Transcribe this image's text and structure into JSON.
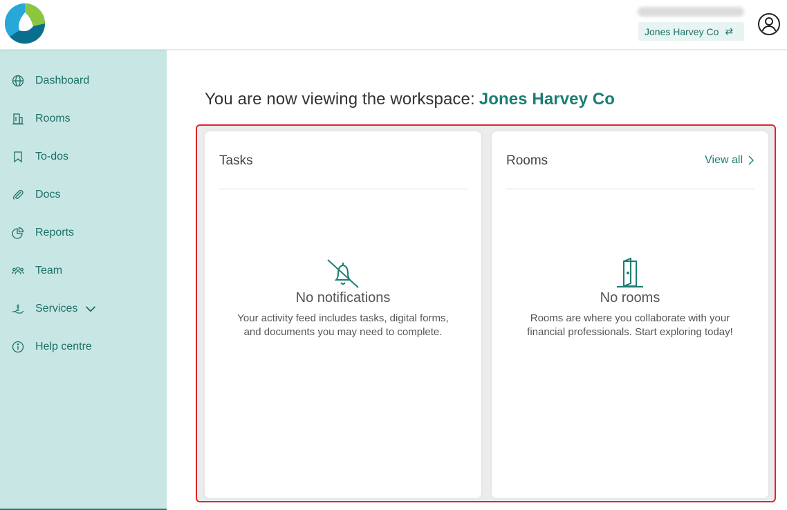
{
  "header": {
    "workspace_switch_label": "Jones Harvey Co",
    "swap_glyph": "⇄",
    "icons": {
      "logo": "app-logo",
      "account": "user-account-icon",
      "swap": "swap-arrows-icon"
    }
  },
  "sidebar": {
    "items": [
      {
        "label": "Dashboard",
        "icon": "globe-icon"
      },
      {
        "label": "Rooms",
        "icon": "building-icon"
      },
      {
        "label": "To-dos",
        "icon": "bookmark-icon"
      },
      {
        "label": "Docs",
        "icon": "paperclip-icon"
      },
      {
        "label": "Reports",
        "icon": "pie-chart-icon"
      },
      {
        "label": "Team",
        "icon": "team-icon"
      },
      {
        "label": "Services",
        "icon": "services-hand-icon"
      },
      {
        "label": "Help centre",
        "icon": "info-icon"
      }
    ]
  },
  "main": {
    "headline_prefix": "You are now viewing the workspace:",
    "headline_workspace": "Jones Harvey Co",
    "tasks_card": {
      "title": "Tasks",
      "empty_title": "No notifications",
      "empty_text": "Your activity feed includes tasks, digital forms, and documents you may need to complete.",
      "icon": "bell-off-icon"
    },
    "rooms_card": {
      "title": "Rooms",
      "view_all": "View all",
      "empty_title": "No rooms",
      "empty_text": "Rooms are where you collaborate with your financial professionals. Start exploring today!",
      "icon": "door-icon"
    }
  },
  "colors": {
    "brand_teal": "#1b7d73",
    "sidebar_bg": "#c8e7e4",
    "highlight_red": "#e0242b"
  }
}
